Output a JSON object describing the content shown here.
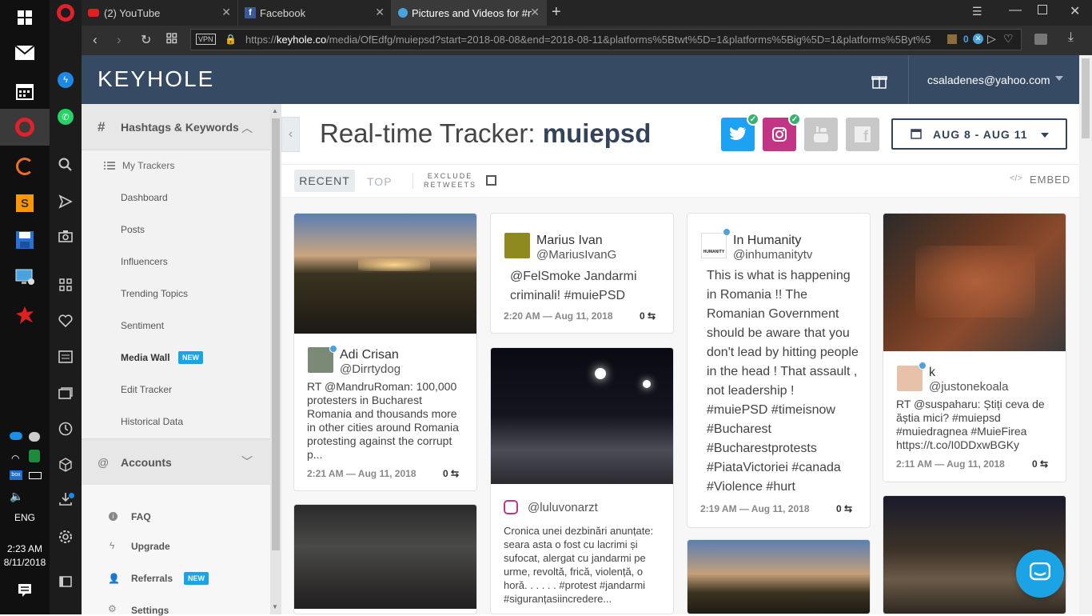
{
  "system": {
    "lang": "ENG",
    "time": "2:23 AM",
    "date": "8/11/2018"
  },
  "tabs": [
    {
      "label": "(2) YouTube"
    },
    {
      "label": "Facebook"
    },
    {
      "label": "Pictures and Videos for #n"
    }
  ],
  "address": {
    "vpn": "VPN",
    "url_prefix": "https://",
    "url_domain": "keyhole.co",
    "url_rest": "/media/OfEdfg/muiepsd?start=2018-08-08&end=2018-08-11&platforms%5Btwt%5D=1&platforms%5Big%5D=1&platforms%5Byt%5",
    "badge_count": "0"
  },
  "header": {
    "logo": "KEYHOLE",
    "user_email": "csaladenes@yahoo.com"
  },
  "sidebar": {
    "section1": "Hashtags & Keywords",
    "my_trackers": "My Trackers",
    "items": [
      "Dashboard",
      "Posts",
      "Influencers",
      "Trending Topics",
      "Sentiment",
      "Media Wall",
      "Edit Tracker",
      "Historical Data"
    ],
    "new_badge": "NEW",
    "section2": "Accounts",
    "footer": [
      "FAQ",
      "Upgrade",
      "Referrals",
      "Settings"
    ]
  },
  "tracker": {
    "title_prefix": "Real-time Tracker:",
    "title_name": "muiepsd",
    "date_range": "AUG 8 - AUG 11",
    "tab_recent": "RECENT",
    "tab_top": "TOP",
    "exclude_line1": "EXCLUDE",
    "exclude_line2": "RETWEETS",
    "embed": "EMBED"
  },
  "colors": {
    "twitter": "#1da1f2",
    "instagram": "#c13584",
    "header": "#364a63",
    "badge": "#1aa4e6"
  },
  "posts": [
    {
      "name": "Adi Crisan",
      "handle": "@Dirrtydog",
      "text": "RT @MandruRoman: 100,000 protesters in Bucharest Romania and thousands more in other cities around Romania protesting against the corrupt p...",
      "time": "2:21 AM — Aug 11, 2018",
      "count": "0"
    },
    {
      "name": "Marius Ivan",
      "handle": "@MariusIvanG",
      "text": "@FelSmoke Jandarmi criminali! #muiePSD",
      "time": "2:20 AM — Aug 11, 2018",
      "count": "0"
    },
    {
      "handle": "@luluvonarzt",
      "text": "Cronica unei dezbinări anunțate: seara asta o fost cu lacrimi și sufocat, alergat cu jandarmi pe urme, revoltă, frică, violență, o horă. . . . . . #protest #jandarmi #siguranțasiincredere..."
    },
    {
      "name": "In Humanity",
      "handle": "@inhumanitytv",
      "avatar_label": "HUMANITY",
      "text": "This is what is happening in Romania !! The Romanian Government should be aware that you don't lead by hitting people in the head ! That assault , not leadership ! #muiePSD #timeisnow #Bucharest #Bucharestprotests #PiataVictoriei #canada #Violence #hurt",
      "time": "2:19 AM — Aug 11, 2018",
      "count": "0"
    },
    {
      "name": "k",
      "handle": "@justonekoala",
      "text": "RT @suspaharu: Știți ceva de ăștia mici? #muiepsd #muiedragnea #MuieFirea https://t.co/I0DDxwBGKy",
      "time": "2:11 AM — Aug 11, 2018",
      "count": "0"
    }
  ]
}
